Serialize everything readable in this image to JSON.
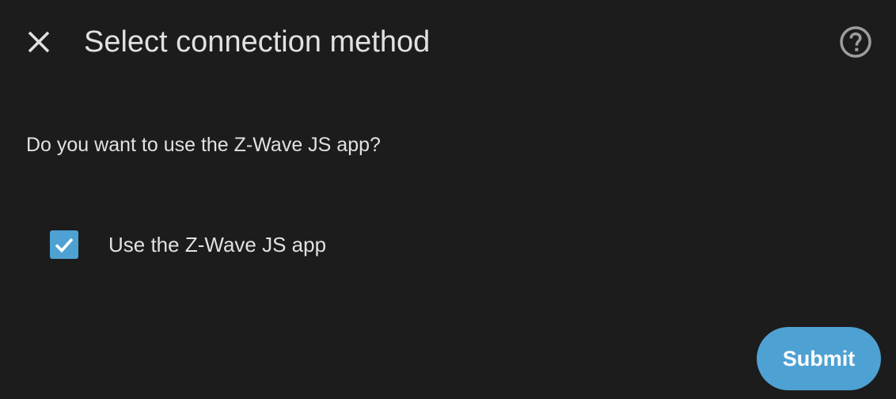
{
  "dialog": {
    "title": "Select connection method",
    "close_icon": "close-icon",
    "help_icon": "help-circle-icon"
  },
  "content": {
    "description": "Do you want to use the Z-Wave JS app?",
    "checkbox": {
      "label": "Use the Z-Wave JS app",
      "checked": true,
      "icon": "checkmark-icon"
    }
  },
  "actions": {
    "submit_label": "Submit"
  },
  "colors": {
    "background": "#1c1c1c",
    "text": "#e1e1e1",
    "accent": "#4ea1d3",
    "icon": "#9e9e9e"
  }
}
